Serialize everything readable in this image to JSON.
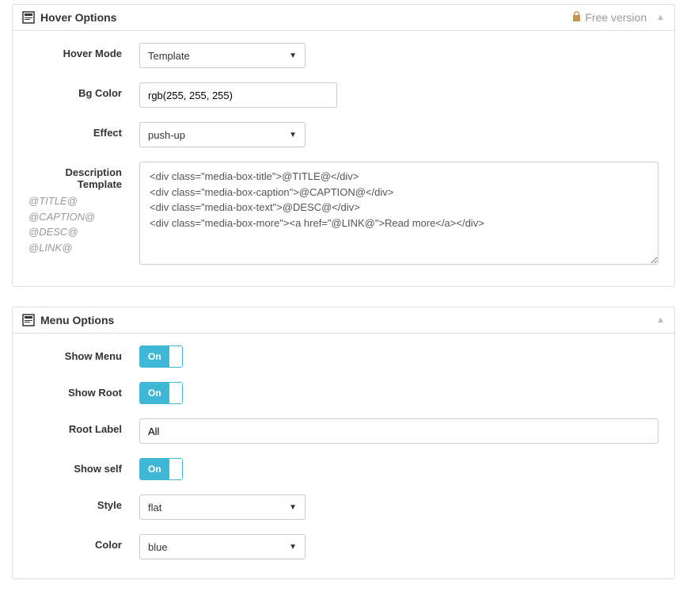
{
  "hover": {
    "title": "Hover Options",
    "free_version_label": "Free version",
    "mode_label": "Hover Mode",
    "mode_value": "Template",
    "bg_color_label": "Bg Color",
    "bg_color_value": "rgb(255, 255, 255)",
    "effect_label": "Effect",
    "effect_value": "push-up",
    "desc_template_label": "Description Template",
    "hint_title": "@TITLE@",
    "hint_caption": "@CAPTION@",
    "hint_desc": "@DESC@",
    "hint_link": "@LINK@",
    "desc_template_value": "<div class=\"media-box-title\">@TITLE@</div>\n<div class=\"media-box-caption\">@CAPTION@</div>\n<div class=\"media-box-text\">@DESC@</div>\n<div class=\"media-box-more\"><a href=\"@LINK@\">Read more</a></div>"
  },
  "menu": {
    "title": "Menu Options",
    "show_menu_label": "Show Menu",
    "show_menu_value": "On",
    "show_root_label": "Show Root",
    "show_root_value": "On",
    "root_label_label": "Root Label",
    "root_label_value": "All",
    "show_self_label": "Show self",
    "show_self_value": "On",
    "style_label": "Style",
    "style_value": "flat",
    "color_label": "Color",
    "color_value": "blue"
  }
}
